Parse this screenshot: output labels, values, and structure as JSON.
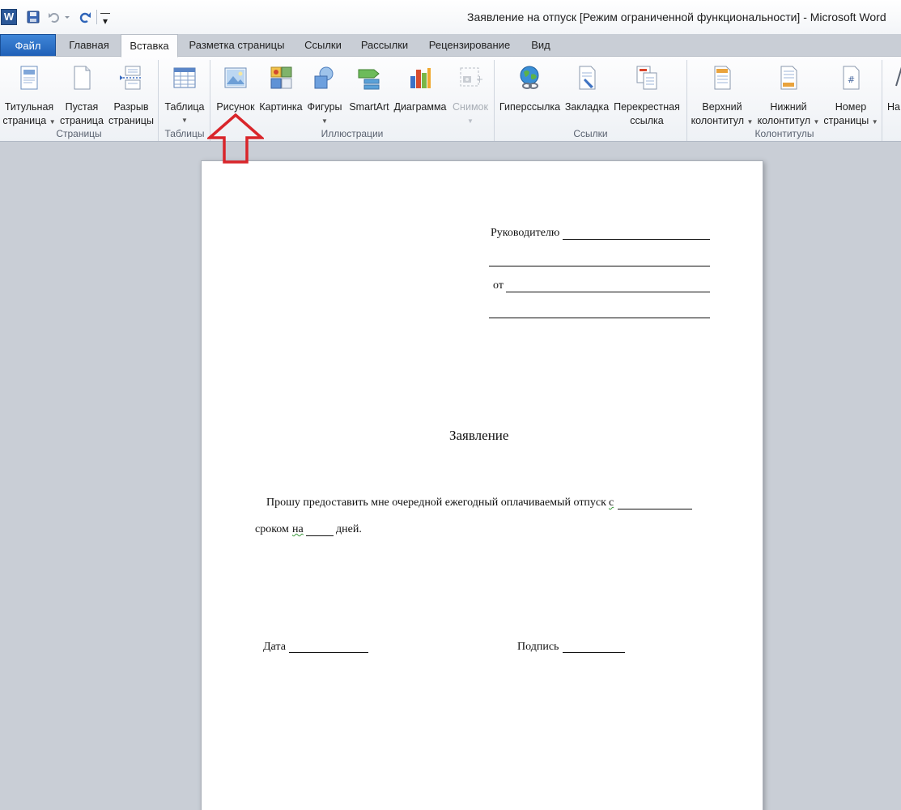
{
  "window": {
    "app_icon_letter": "W",
    "title": "Заявление на отпуск [Режим ограниченной функциональности]  -  Microsoft Word"
  },
  "quick_access": {
    "customize_glyph": "▾"
  },
  "tabs": {
    "file": "Файл",
    "items": [
      "Главная",
      "Вставка",
      "Разметка страницы",
      "Ссылки",
      "Рассылки",
      "Рецензирование",
      "Вид"
    ],
    "active": "Вставка"
  },
  "ribbon": {
    "groups": {
      "pages": "Страницы",
      "tables": "Таблицы",
      "illustrations": "Иллюстрации",
      "links": "Ссылки",
      "header_footer": "Колонтитулы"
    },
    "buttons": {
      "cover_page": [
        "Титульная",
        "страница"
      ],
      "blank_page": [
        "Пустая",
        "страница"
      ],
      "page_break": [
        "Разрыв",
        "страницы"
      ],
      "table": "Таблица",
      "picture": "Рисунок",
      "clip_art": "Картинка",
      "shapes": "Фигуры",
      "smartart": "SmartArt",
      "chart": "Диаграмма",
      "screenshot": "Снимок",
      "hyperlink": "Гиперссылка",
      "bookmark": "Закладка",
      "cross_ref": [
        "Перекрестная",
        "ссылка"
      ],
      "header": [
        "Верхний",
        "колонтитул"
      ],
      "footer": [
        "Нижний",
        "колонтитул"
      ],
      "page_number": [
        "Номер",
        "страницы"
      ],
      "next_partial": "На"
    },
    "colors": {
      "annotation_arrow": "#d9252a",
      "file_tab": "#2a6bc5"
    }
  },
  "document": {
    "to_manager": "Руководителю",
    "from": "от",
    "heading": "Заявление",
    "body_line1": "Прошу предоставить мне очередной ежегодный оплачиваемый отпуск",
    "body_line1_c": "с",
    "body_line2_start": "сроком",
    "body_line2_na": "на",
    "body_line2_end": "дней.",
    "date_label": "Дата",
    "signature_label": "Подпись"
  }
}
